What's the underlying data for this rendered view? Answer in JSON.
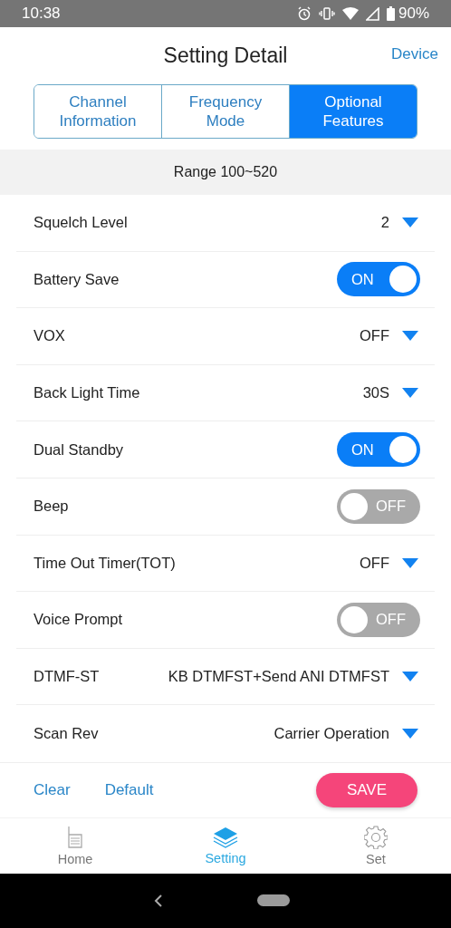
{
  "status_bar": {
    "time": "10:38",
    "battery": "90%"
  },
  "header": {
    "title": "Setting Detail",
    "action": "Device"
  },
  "tabs": [
    {
      "lines": [
        "Channel",
        "Information"
      ],
      "selected": false
    },
    {
      "lines": [
        "Frequency",
        "Mode"
      ],
      "selected": false
    },
    {
      "lines": [
        "Optional",
        "Features"
      ],
      "selected": true
    }
  ],
  "range": "Range 100~520",
  "settings": [
    {
      "kind": "dropdown",
      "label": "Squelch Level",
      "value": "2"
    },
    {
      "kind": "toggle",
      "label": "Battery Save",
      "on": true,
      "state_label": "ON"
    },
    {
      "kind": "dropdown",
      "label": "VOX",
      "value": "OFF"
    },
    {
      "kind": "dropdown",
      "label": "Back Light Time",
      "value": "30S"
    },
    {
      "kind": "toggle",
      "label": "Dual Standby",
      "on": true,
      "state_label": "ON"
    },
    {
      "kind": "toggle",
      "label": "Beep",
      "on": false,
      "state_label": "OFF"
    },
    {
      "kind": "dropdown",
      "label": "Time Out Timer(TOT)",
      "value": "OFF"
    },
    {
      "kind": "toggle",
      "label": "Voice Prompt",
      "on": false,
      "state_label": "OFF"
    },
    {
      "kind": "dropdown",
      "label": "DTMF-ST",
      "value": "KB DTMFST+Send ANI DTMFST"
    },
    {
      "kind": "dropdown",
      "label": "Scan Rev",
      "value": "Carrier Operation"
    }
  ],
  "actions": {
    "clear": "Clear",
    "default": "Default",
    "save": "SAVE"
  },
  "bottom_nav": [
    {
      "kind": "home",
      "label": "Home",
      "selected": false
    },
    {
      "kind": "setting",
      "label": "Setting",
      "selected": true
    },
    {
      "kind": "set",
      "label": "Set",
      "selected": false
    }
  ]
}
